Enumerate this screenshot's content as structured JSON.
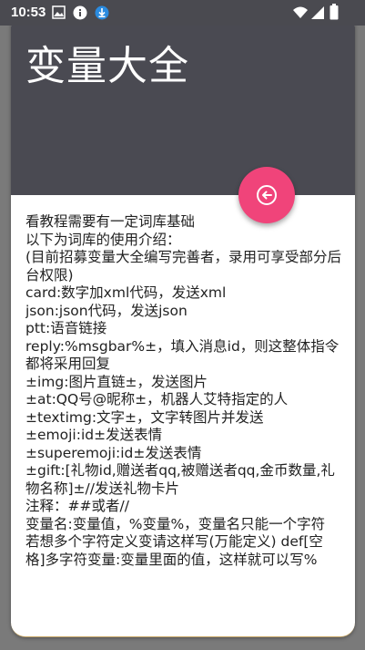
{
  "status_bar": {
    "time": "10:53"
  },
  "dialog": {
    "title": "变量大全",
    "lines": [
      "看教程需要有一定词库基础",
      "以下为词库的使用介绍：",
      "(目前招募变量大全编写完善者，录用可享受部分后台权限)",
      "card:数字加xml代码，发送xml",
      "json:json代码，发送json",
      "ptt:语音链接",
      "reply:%msgbar%±，填入消息id，则这整体指令都将采用回复",
      "±img:图片直链±，发送图片",
      "±at:QQ号@昵称±，机器人艾特指定的人",
      "±textimg:文字±，文字转图片并发送",
      "±emoji:id±发送表情",
      "±superemoji:id±发送表情",
      "±gift:[礼物id,赠送者qq,被赠送者qq,金币数量,礼物名称]±//发送礼物卡片",
      "注释：##或者//",
      "变量名:变量值，%变量%，变量名只能一个字符",
      "若想多个字符定义变请这样写(万能定义) def[空格]多字符变量:变量里面的值，这样就可以写%"
    ]
  },
  "icons": {
    "fab": "back-arrow-circle-icon",
    "status": [
      "image-icon",
      "info-icon",
      "download-icon",
      "wifi-icon",
      "signal-icon",
      "battery-icon"
    ]
  },
  "colors": {
    "header": "#4a4a52",
    "fab": "#f0447a",
    "text": "#222222"
  }
}
